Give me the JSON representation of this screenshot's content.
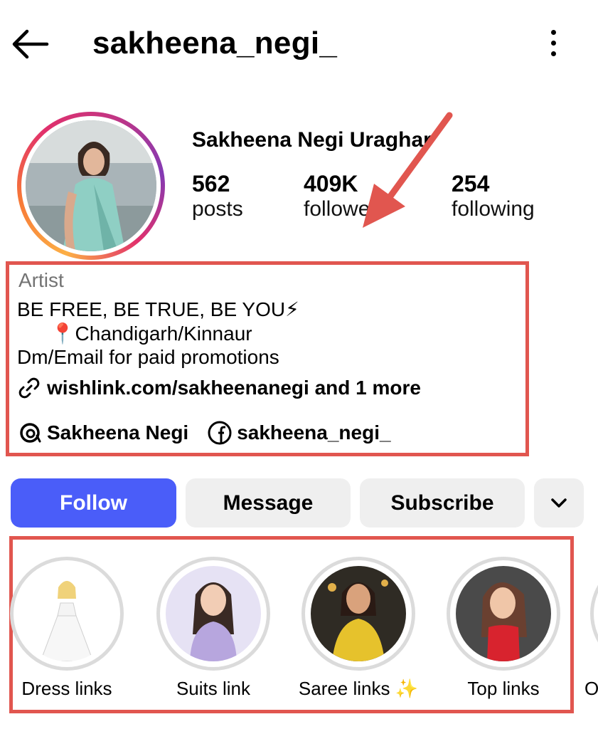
{
  "header": {
    "username": "sakheena_negi_",
    "back_icon": "arrow-left-icon",
    "more_icon": "more-vertical-icon"
  },
  "profile": {
    "display_name": "Sakheena Negi Uraghar",
    "stats": [
      {
        "value": "562",
        "label": "posts"
      },
      {
        "value": "409K",
        "label": "followers"
      },
      {
        "value": "254",
        "label": "following"
      }
    ]
  },
  "bio": {
    "category": "Artist",
    "line1": "BE FREE, BE TRUE, BE YOU⚡",
    "line2": "      📍Chandigarh/Kinnaur",
    "line3": "Dm/Email for paid promotions",
    "link": "wishlink.com/sakheenanegi and 1 more",
    "threads_name": "Sakheena Negi",
    "facebook_name": "sakheena_negi_"
  },
  "actions": {
    "follow": "Follow",
    "message": "Message",
    "subscribe": "Subscribe"
  },
  "highlights": [
    {
      "label": "Dress links"
    },
    {
      "label": "Suits link"
    },
    {
      "label": "Saree links ✨"
    },
    {
      "label": "Top links"
    },
    {
      "label": "O"
    }
  ],
  "colors": {
    "follow_bg": "#4a5df9",
    "annotation_red": "#e1564f",
    "secondary_btn": "#efefef"
  }
}
